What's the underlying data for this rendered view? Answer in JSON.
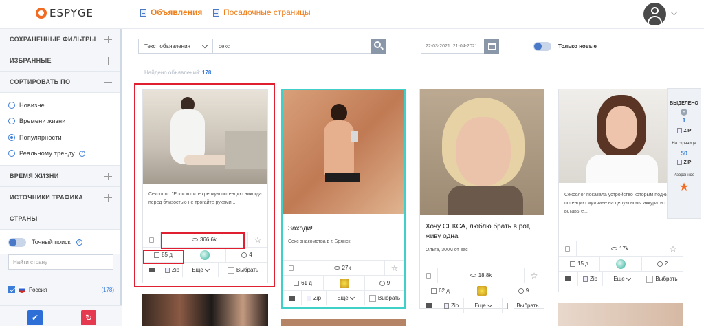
{
  "header": {
    "logo_text": "ESPYGE",
    "nav": [
      {
        "label": "Объявления",
        "active": true
      },
      {
        "label": "Посадочные страницы",
        "active": false
      }
    ]
  },
  "sidebar": {
    "sections": {
      "saved_filters": "СОХРАНЕННЫЕ ФИЛЬТРЫ",
      "favorites": "ИЗБРАННЫЕ",
      "sort_by": "СОРТИРОВАТЬ ПО",
      "lifetime": "ВРЕМЯ ЖИЗНИ",
      "traffic_sources": "ИСТОЧНИКИ ТРАФИКА",
      "countries": "СТРАНЫ"
    },
    "sort_options": [
      {
        "label": "Новизне",
        "selected": false
      },
      {
        "label": "Времени жизни",
        "selected": false
      },
      {
        "label": "Популярности",
        "selected": true
      },
      {
        "label": "Реальному тренду",
        "selected": false
      }
    ],
    "exact_search_label": "Точный поиск",
    "country_search_placeholder": "Найти страну",
    "country": {
      "name": "Россия",
      "count": "(178)"
    }
  },
  "search": {
    "field_select": "Текст объявления",
    "query": "секс",
    "date_range": "22-03-2021..21-04-2021",
    "new_only_label": "Только новые",
    "found_label": "Найдено объявлений:",
    "found_count": "178"
  },
  "cards": [
    {
      "title": "",
      "desc": "Сексолог: \"Если хотите крепкую потенцию никогда перед близостью не трогайте руками...",
      "views": "366.6k",
      "days": "85 д",
      "geo": "4"
    },
    {
      "title": "Заходи!",
      "desc": "Секс знакомства в г. Брянск",
      "views": "27k",
      "days": "61 д",
      "geo": "9"
    },
    {
      "title": "Хочу СЕКСА, люблю брать в рот, живу одна",
      "desc": "Ольга, 300м от вас",
      "views": "18.8k",
      "days": "62 д",
      "geo": "9"
    },
    {
      "title": "",
      "desc": "Сексолог показала устройство которым поднимает потенцию мужчине на целую ночь: аккуратно вставьте...",
      "views": "17k",
      "days": "15 д",
      "geo": "2"
    }
  ],
  "card_actions": {
    "zip": "Zip",
    "more": "Еще",
    "choose": "Выбрать"
  },
  "selection_panel": {
    "title": "ВЫДЕЛЕНО",
    "selected_count": "1",
    "zip": "ZIP",
    "per_page_label": "На странице",
    "per_page_count": "50",
    "favorites_label": "Избранное"
  }
}
